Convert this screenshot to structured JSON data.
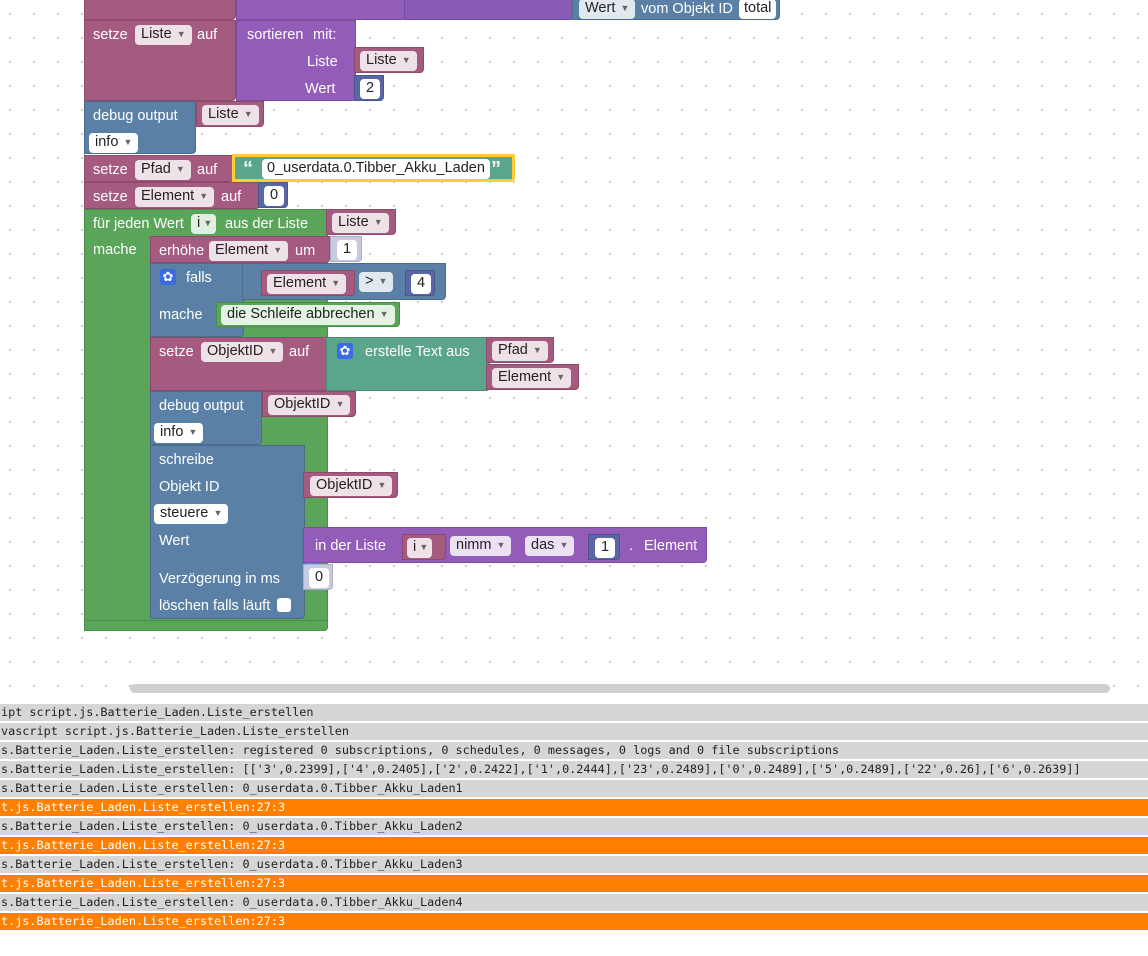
{
  "blocks": {
    "top": {
      "value_label": "Wert",
      "object_label": "vom Objekt ID",
      "object_value": "total"
    },
    "sort": {
      "set_label": "setze",
      "var": "Liste",
      "to_label": "auf",
      "sort_label": "sortieren",
      "with_label": "mit:",
      "list_label": "Liste",
      "list_var": "Liste",
      "value_label": "Wert",
      "value": "2"
    },
    "debug1": {
      "label": "debug output",
      "var": "Liste",
      "level": "info"
    },
    "set_path": {
      "set_label": "setze",
      "var": "Pfad",
      "to_label": "auf",
      "string": "0_userdata.0.Tibber_Akku_Laden"
    },
    "set_element": {
      "set_label": "setze",
      "var": "Element",
      "to_label": "auf",
      "value": "0"
    },
    "foreach": {
      "label": "für jeden Wert",
      "var": "i",
      "from_label": "aus der Liste",
      "list": "Liste",
      "do_label": "mache"
    },
    "increment": {
      "label": "erhöhe",
      "var": "Element",
      "by_label": "um",
      "value": "1"
    },
    "if": {
      "label": "falls",
      "left": "Element",
      "op": ">",
      "right": "4",
      "do_label": "mache",
      "break_label": "die Schleife abbrechen"
    },
    "set_objid": {
      "set_label": "setze",
      "var": "ObjektID",
      "to_label": "auf",
      "join_label": "erstelle Text aus",
      "item1": "Pfad",
      "item2": "Element"
    },
    "debug2": {
      "label": "debug output",
      "var": "ObjektID",
      "level": "info"
    },
    "write": {
      "label": "schreibe",
      "objid_label": "Objekt ID",
      "objid_var": "ObjektID",
      "mode": "steuere",
      "value_label": "Wert",
      "list_label": "in der Liste",
      "list_var": "i",
      "take": "nimm",
      "the": "das",
      "index": "1",
      "dot": ".",
      "element_label": "Element",
      "delay_label": "Verzögerung in ms",
      "delay": "0",
      "clear_label": "löschen falls läuft"
    }
  },
  "log": [
    {
      "type": "info",
      "text": "ipt script.js.Batterie_Laden.Liste_erstellen"
    },
    {
      "type": "info",
      "text": "vascript script.js.Batterie_Laden.Liste_erstellen"
    },
    {
      "type": "info",
      "text": "s.Batterie_Laden.Liste_erstellen: registered 0 subscriptions, 0 schedules, 0 messages, 0 logs and 0 file subscriptions"
    },
    {
      "type": "info",
      "text": "s.Batterie_Laden.Liste_erstellen: [['3',0.2399],['4',0.2405],['2',0.2422],['1',0.2444],['23',0.2489],['0',0.2489],['5',0.2489],['22',0.26],['6',0.2639]]"
    },
    {
      "type": "info",
      "text": "s.Batterie_Laden.Liste_erstellen: 0_userdata.0.Tibber_Akku_Laden1"
    },
    {
      "type": "warn",
      "text": "t.js.Batterie_Laden.Liste_erstellen:27:3"
    },
    {
      "type": "info",
      "text": "s.Batterie_Laden.Liste_erstellen: 0_userdata.0.Tibber_Akku_Laden2"
    },
    {
      "type": "warn",
      "text": "t.js.Batterie_Laden.Liste_erstellen:27:3"
    },
    {
      "type": "info",
      "text": "s.Batterie_Laden.Liste_erstellen: 0_userdata.0.Tibber_Akku_Laden3"
    },
    {
      "type": "warn",
      "text": "t.js.Batterie_Laden.Liste_erstellen:27:3"
    },
    {
      "type": "info",
      "text": "s.Batterie_Laden.Liste_erstellen: 0_userdata.0.Tibber_Akku_Laden4"
    },
    {
      "type": "warn",
      "text": "t.js.Batterie_Laden.Liste_erstellen:27:3"
    }
  ],
  "colors": {
    "variables": "#a55b80",
    "lists": "#935cb8",
    "system": "#5b80a5",
    "loops": "#5ba55b",
    "text": "#5ba58c",
    "math": "#5b67a5",
    "log_info_bg": "#d6d6d6",
    "log_warn_bg": "#ff8000"
  }
}
